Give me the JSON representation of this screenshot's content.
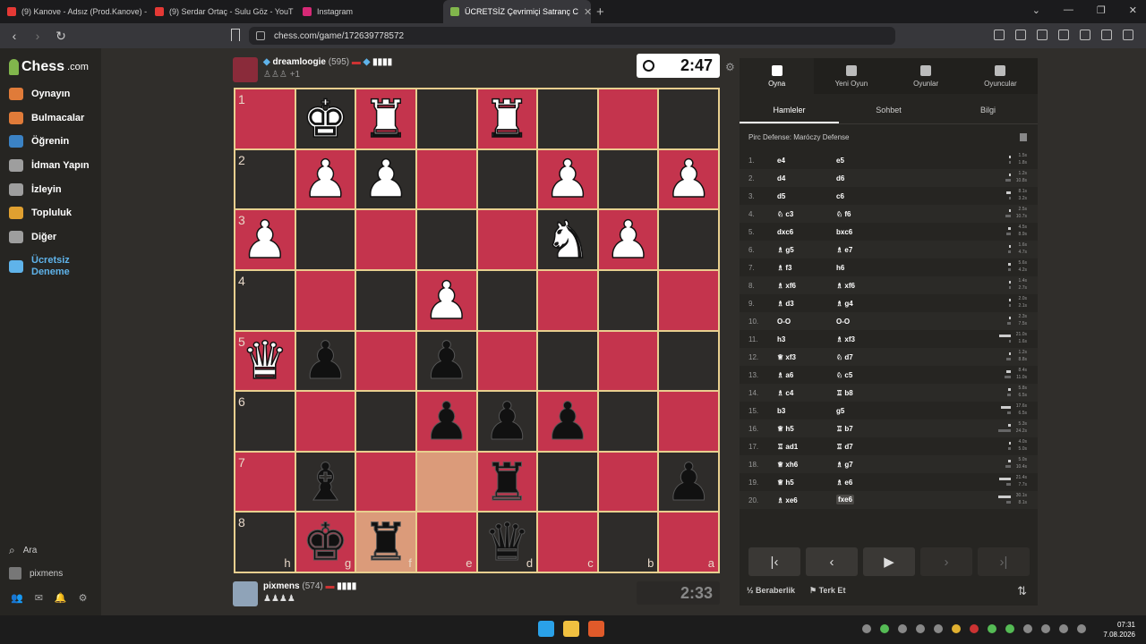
{
  "browser": {
    "tabs": [
      {
        "title": "(9) Kanove - Adsız (Prod.Kanove) - Yo",
        "color": "#e53935",
        "active": false
      },
      {
        "title": "(9) Serdar Ortaç - Sulu Göz - YouT",
        "color": "#e53935",
        "active": false
      },
      {
        "title": "Instagram",
        "color": "#d62976",
        "active": false
      },
      {
        "title": "ÜCRETSİZ Çevrimiçi Satranç C",
        "color": "#81b64c",
        "active": true
      }
    ],
    "url": "chess.com/game/172639778572"
  },
  "sidebar": {
    "logo": "Chess",
    "logo_suffix": ".com",
    "items": [
      {
        "label": "Oynayın",
        "icon": "play-icon",
        "color": "#e07b39"
      },
      {
        "label": "Bulmacalar",
        "icon": "puzzle-icon",
        "color": "#e07b39"
      },
      {
        "label": "Öğrenin",
        "icon": "learn-icon",
        "color": "#3b82c4"
      },
      {
        "label": "İdman Yapın",
        "icon": "train-icon",
        "color": "#9e9e9e"
      },
      {
        "label": "İzleyin",
        "icon": "watch-icon",
        "color": "#9e9e9e"
      },
      {
        "label": "Topluluk",
        "icon": "community-icon",
        "color": "#e0a030"
      },
      {
        "label": "Diğer",
        "icon": "more-icon",
        "color": "#9e9e9e"
      },
      {
        "label": "Ücretsiz Deneme",
        "icon": "diamond-icon",
        "color": "#5fb3ea"
      }
    ],
    "search": "Ara",
    "user": "pixmens"
  },
  "top_player": {
    "name": "dreamloogie",
    "rating": "(595)",
    "captured": "♙♙♙",
    "captured_extra": "+1",
    "clock": "2:47"
  },
  "bottom_player": {
    "name": "pixmens",
    "rating": "(574)",
    "captured": "♟♟♟♟",
    "clock": "2:33"
  },
  "board": {
    "ranks": [
      "1",
      "2",
      "3",
      "4",
      "5",
      "6",
      "7",
      "8"
    ],
    "files": [
      "h",
      "g",
      "f",
      "e",
      "d",
      "c",
      "b",
      "a"
    ],
    "rows": [
      [
        "",
        "wK",
        "wR",
        "",
        "wR",
        "",
        "",
        ""
      ],
      [
        "",
        "wP",
        "wP",
        "",
        "",
        "wP",
        "",
        "wP"
      ],
      [
        "wP",
        "",
        "",
        "",
        "",
        "wN",
        "wP",
        ""
      ],
      [
        "",
        "",
        "",
        "wP",
        "",
        "",
        "",
        ""
      ],
      [
        "wQ",
        "bP",
        "",
        "bP",
        "",
        "",
        "",
        ""
      ],
      [
        "",
        "",
        "",
        "bP",
        "bP",
        "bP",
        "",
        ""
      ],
      [
        "",
        "bB",
        "",
        "",
        "bR",
        "",
        "",
        "bP"
      ],
      [
        "",
        "bK",
        "bR",
        "",
        "bQ",
        "",
        "",
        ""
      ]
    ],
    "highlights": [
      "6-3",
      "7-2"
    ]
  },
  "panel": {
    "top_tabs": [
      "Oyna",
      "Yeni Oyun",
      "Oyunlar",
      "Oyuncular"
    ],
    "sub_tabs": [
      "Hamleler",
      "Sohbet",
      "Bilgi"
    ],
    "opening": "Pirc Defense: Maróczy Defense",
    "moves": [
      {
        "n": "1.",
        "w": "e4",
        "b": "e5",
        "tw": "1.5s",
        "tb": "1.8s"
      },
      {
        "n": "2.",
        "w": "d4",
        "b": "d6",
        "tw": "1.2s",
        "tb": "10.8s"
      },
      {
        "n": "3.",
        "w": "d5",
        "b": "c6",
        "tw": "8.1s",
        "tb": "3.2s"
      },
      {
        "n": "4.",
        "w": "♘ c3",
        "b": "♘ f6",
        "tw": "2.5s",
        "tb": "10.7s"
      },
      {
        "n": "5.",
        "w": "dxc6",
        "b": "bxc6",
        "tw": "4.5s",
        "tb": "8.9s"
      },
      {
        "n": "6.",
        "w": "♗ g5",
        "b": "♗ e7",
        "tw": "1.6s",
        "tb": "4.7s"
      },
      {
        "n": "7.",
        "w": "♗ f3",
        "b": "h6",
        "tw": "5.6s",
        "tb": "4.2s"
      },
      {
        "n": "8.",
        "w": "♗ xf6",
        "b": "♗ xf6",
        "tw": "1.4s",
        "tb": "2.7s"
      },
      {
        "n": "9.",
        "w": "♗ d3",
        "b": "♗ g4",
        "tw": "2.0s",
        "tb": "2.1s"
      },
      {
        "n": "10.",
        "w": "O-O",
        "b": "O-O",
        "tw": "2.3s",
        "tb": "7.5s"
      },
      {
        "n": "11.",
        "w": "h3",
        "b": "♗ xf3",
        "tw": "21.0s",
        "tb": "1.6s"
      },
      {
        "n": "12.",
        "w": "♕ xf3",
        "b": "♘ d7",
        "tw": "1.2s",
        "tb": "8.8s"
      },
      {
        "n": "13.",
        "w": "♗ a6",
        "b": "♘ c5",
        "tw": "8.4s",
        "tb": "11.0s"
      },
      {
        "n": "14.",
        "w": "♗ c4",
        "b": "♖ b8",
        "tw": "5.8s",
        "tb": "6.5s"
      },
      {
        "n": "15.",
        "w": "b3",
        "b": "g5",
        "tw": "17.6s",
        "tb": "6.5s"
      },
      {
        "n": "16.",
        "w": "♕ h5",
        "b": "♖ b7",
        "tw": "5.3s",
        "tb": "24.2s"
      },
      {
        "n": "17.",
        "w": "♖ ad1",
        "b": "♖ d7",
        "tw": "4.0s",
        "tb": "5.0s"
      },
      {
        "n": "18.",
        "w": "♕ xh6",
        "b": "♗ g7",
        "tw": "5.0s",
        "tb": "10.4s"
      },
      {
        "n": "19.",
        "w": "♕ h5",
        "b": "♗ e6",
        "tw": "21.4s",
        "tb": "7.7s"
      },
      {
        "n": "20.",
        "w": "♗ xe6",
        "b": "fxe6",
        "tw": "30.1s",
        "tb": "8.1s"
      }
    ],
    "draw": "½ Beraberlik",
    "resign": "Terk Et"
  },
  "taskbar": {
    "time": "07:31",
    "date": "7.08.2026"
  }
}
